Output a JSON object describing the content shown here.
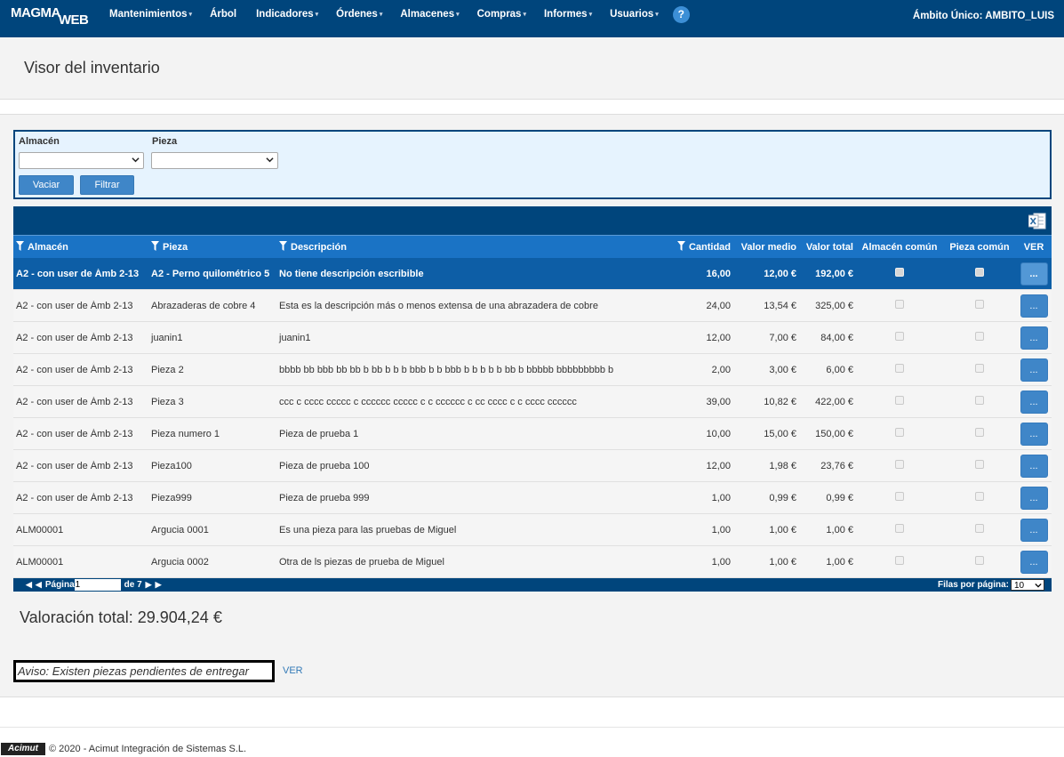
{
  "brand": {
    "line1": "MAGMA",
    "line2": "WEB"
  },
  "nav": [
    {
      "label": "Mantenimientos",
      "caret": "▾"
    },
    {
      "label": "Árbol",
      "caret": ""
    },
    {
      "label": "Indicadores",
      "caret": "▾"
    },
    {
      "label": "Órdenes",
      "caret": "▾"
    },
    {
      "label": "Almacenes",
      "caret": "▾"
    },
    {
      "label": "Compras",
      "caret": "▾"
    },
    {
      "label": "Informes",
      "caret": "▾"
    },
    {
      "label": "Usuarios",
      "caret": "▾"
    }
  ],
  "help": "?",
  "scope": "Ámbito Único: AMBITO_LUIS",
  "page_title": "Visor del inventario",
  "filters": {
    "almacen_label": "Almacén",
    "almacen_value": "",
    "pieza_label": "Pieza",
    "pieza_value": "",
    "clear_label": "Vaciar",
    "filter_label": "Filtrar"
  },
  "grid": {
    "columns": [
      "Almacén",
      "Pieza",
      "Descripción",
      "Cantidad",
      "Valor medio",
      "Valor total",
      "Almacén común",
      "Pieza común",
      "VER"
    ],
    "ver_label": "...",
    "rows": [
      {
        "almacen": "A2 - con user de Ámb 2-13",
        "pieza": "A2 - Perno quilométrico 5",
        "descripcion": "No tiene descripción escribible",
        "cantidad": "16,00",
        "valor_medio": "12,00 €",
        "valor_total": "192,00 €",
        "almacen_comun": false,
        "pieza_comun": false,
        "selected": true
      },
      {
        "almacen": "A2 - con user de Ámb 2-13",
        "pieza": "Abrazaderas de cobre 4",
        "descripcion": "Esta es la descripción más o menos extensa de una abrazadera de cobre",
        "cantidad": "24,00",
        "valor_medio": "13,54 €",
        "valor_total": "325,00 €",
        "almacen_comun": false,
        "pieza_comun": false,
        "selected": false
      },
      {
        "almacen": "A2 - con user de Ámb 2-13",
        "pieza": "juanin1",
        "descripcion": "juanin1",
        "cantidad": "12,00",
        "valor_medio": "7,00 €",
        "valor_total": "84,00 €",
        "almacen_comun": false,
        "pieza_comun": false,
        "selected": false
      },
      {
        "almacen": "A2 - con user de Ámb 2-13",
        "pieza": "Pieza 2",
        "descripcion": "bbbb bb bbb bb bb b bb b b b bbb b b bbb b b b b b bb b bbbbb bbbbbbbbb b",
        "cantidad": "2,00",
        "valor_medio": "3,00 €",
        "valor_total": "6,00 €",
        "almacen_comun": false,
        "pieza_comun": false,
        "selected": false
      },
      {
        "almacen": "A2 - con user de Ámb 2-13",
        "pieza": "Pieza 3",
        "descripcion": "ccc c cccc ccccc c cccccc ccccc c c cccccc c cc cccc c c cccc cccccc",
        "cantidad": "39,00",
        "valor_medio": "10,82 €",
        "valor_total": "422,00 €",
        "almacen_comun": false,
        "pieza_comun": false,
        "selected": false
      },
      {
        "almacen": "A2 - con user de Ámb 2-13",
        "pieza": "Pieza numero 1",
        "descripcion": "Pieza de prueba 1",
        "cantidad": "10,00",
        "valor_medio": "15,00 €",
        "valor_total": "150,00 €",
        "almacen_comun": false,
        "pieza_comun": false,
        "selected": false
      },
      {
        "almacen": "A2 - con user de Ámb 2-13",
        "pieza": "Pieza100",
        "descripcion": "Pieza de prueba 100",
        "cantidad": "12,00",
        "valor_medio": "1,98 €",
        "valor_total": "23,76 €",
        "almacen_comun": false,
        "pieza_comun": false,
        "selected": false
      },
      {
        "almacen": "A2 - con user de Ámb 2-13",
        "pieza": "Pieza999",
        "descripcion": "Pieza de prueba 999",
        "cantidad": "1,00",
        "valor_medio": "0,99 €",
        "valor_total": "0,99 €",
        "almacen_comun": false,
        "pieza_comun": false,
        "selected": false
      },
      {
        "almacen": "ALM00001",
        "pieza": "Argucia 0001",
        "descripcion": "Es una pieza para las pruebas de Miguel",
        "cantidad": "1,00",
        "valor_medio": "1,00 €",
        "valor_total": "1,00 €",
        "almacen_comun": false,
        "pieza_comun": false,
        "selected": false
      },
      {
        "almacen": "ALM00001",
        "pieza": "Argucia 0002",
        "descripcion": "Otra de ls piezas de prueba de Miguel",
        "cantidad": "1,00",
        "valor_medio": "1,00 €",
        "valor_total": "1,00 €",
        "almacen_comun": false,
        "pieza_comun": false,
        "selected": false
      }
    ]
  },
  "pager": {
    "page_label": "Página",
    "page_value": "1",
    "of_label": "de 7",
    "rows_label": "Filas por página:",
    "rows_value": "10"
  },
  "total": "Valoración total: 29.904,24 €",
  "notice": {
    "text": "Aviso: Existen piezas pendientes de entregar",
    "link": "VER"
  },
  "footer": {
    "logo": "Acimut",
    "text": "© 2020 - Acimut Integración de Sistemas S.L."
  }
}
